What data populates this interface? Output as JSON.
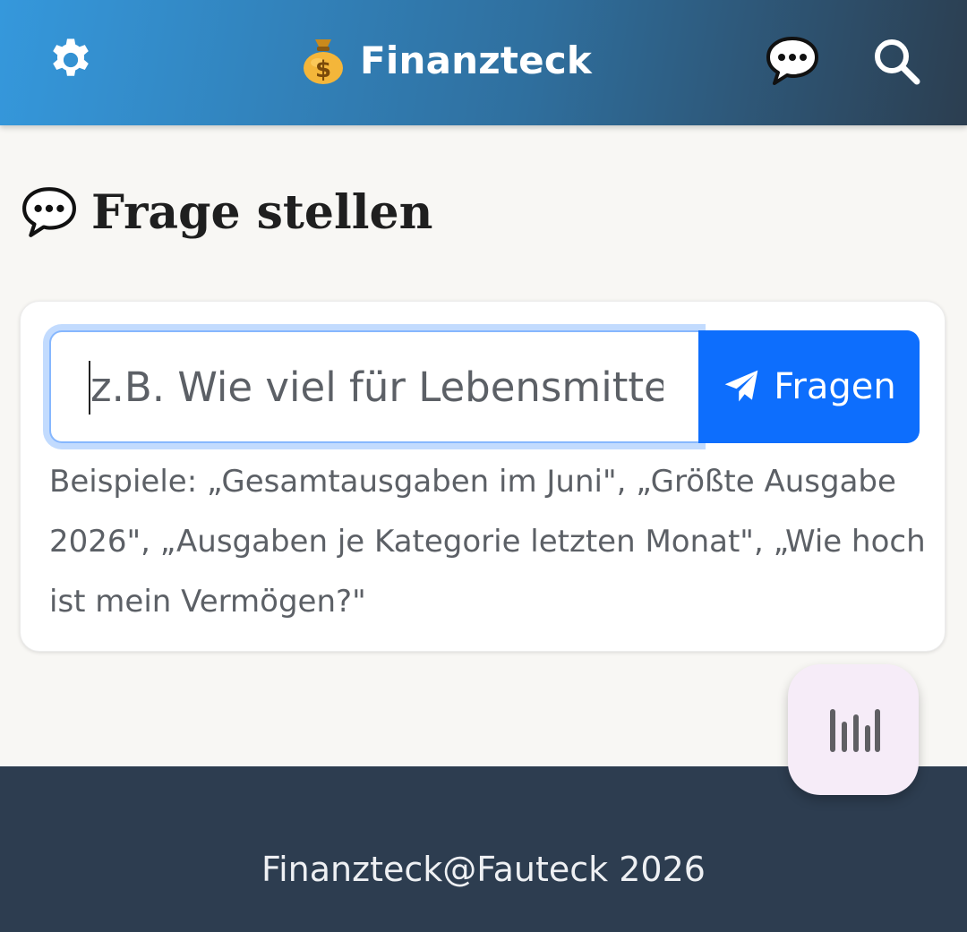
{
  "header": {
    "title": "Finanzteck",
    "settings_icon": "gear-icon",
    "brand_icon": "money-bag-icon",
    "chat_icon": "speech-bubble-icon",
    "search_icon": "search-icon",
    "gradient_colors": [
      "#3598dc",
      "#2c3e50"
    ]
  },
  "main": {
    "title": "Frage stellen",
    "title_icon": "speech-bubble-icon",
    "query": {
      "value": "",
      "placeholder": "z.B. Wie viel für Lebensmittel"
    },
    "ask_button": {
      "label": "Fragen",
      "icon": "paper-plane-icon",
      "color": "#0d6efd"
    },
    "examples_text": "Beispiele: „Gesamtausgaben im Juni\", „Größte Ausgabe 2026\", „Ausgaben je Kategorie letzten Monat\", „Wie hoch ist mein Vermögen?\""
  },
  "fab": {
    "icon": "voice-wave-icon"
  },
  "footer": {
    "text": "Finanzteck@Fauteck 2026",
    "background": "#2d3d50"
  }
}
